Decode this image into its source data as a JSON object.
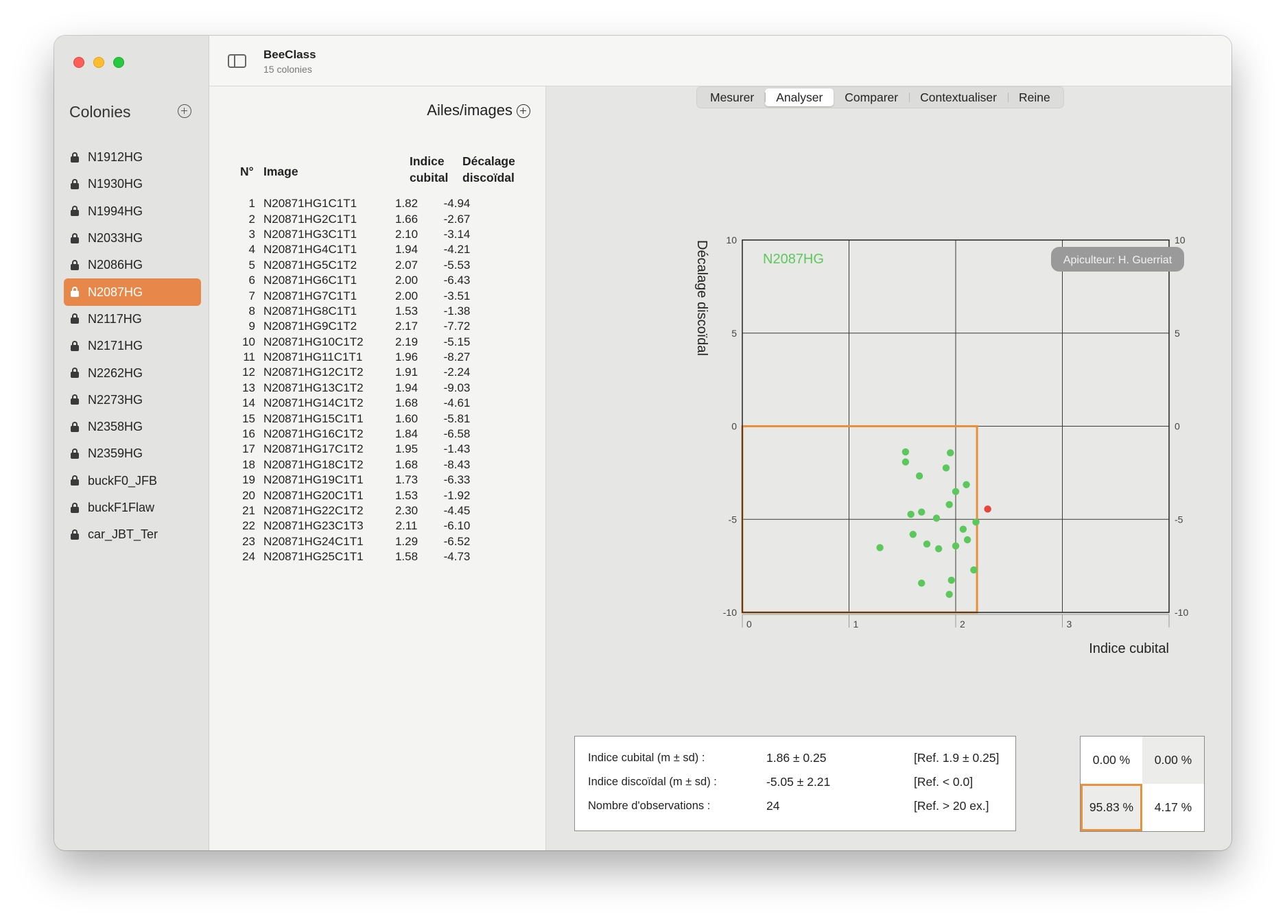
{
  "app": {
    "title": "BeeClass",
    "subtitle": "15 colonies"
  },
  "sidebar": {
    "title": "Colonies",
    "items": [
      {
        "label": "N1912HG"
      },
      {
        "label": "N1930HG"
      },
      {
        "label": "N1994HG"
      },
      {
        "label": "N2033HG"
      },
      {
        "label": "N2086HG"
      },
      {
        "label": "N2087HG",
        "selected": true
      },
      {
        "label": "N2117HG"
      },
      {
        "label": "N2171HG"
      },
      {
        "label": "N2262HG"
      },
      {
        "label": "N2273HG"
      },
      {
        "label": "N2358HG"
      },
      {
        "label": "N2359HG"
      },
      {
        "label": "buckF0_JFB"
      },
      {
        "label": "buckF1Flaw"
      },
      {
        "label": "car_JBT_Ter"
      }
    ]
  },
  "wings": {
    "title": "Ailes/images",
    "headers": {
      "num": "N°",
      "image": "Image",
      "cubital": "Indice cubital",
      "discoidal": "Décalage discoïdal"
    },
    "rows": [
      {
        "n": "1",
        "image": "N20871HG1C1T1",
        "ci": "1.82",
        "dd": "-4.94"
      },
      {
        "n": "2",
        "image": "N20871HG2C1T1",
        "ci": "1.66",
        "dd": "-2.67"
      },
      {
        "n": "3",
        "image": "N20871HG3C1T1",
        "ci": "2.10",
        "dd": "-3.14"
      },
      {
        "n": "4",
        "image": "N20871HG4C1T1",
        "ci": "1.94",
        "dd": "-4.21"
      },
      {
        "n": "5",
        "image": "N20871HG5C1T2",
        "ci": "2.07",
        "dd": "-5.53"
      },
      {
        "n": "6",
        "image": "N20871HG6C1T1",
        "ci": "2.00",
        "dd": "-6.43"
      },
      {
        "n": "7",
        "image": "N20871HG7C1T1",
        "ci": "2.00",
        "dd": "-3.51"
      },
      {
        "n": "8",
        "image": "N20871HG8C1T1",
        "ci": "1.53",
        "dd": "-1.38"
      },
      {
        "n": "9",
        "image": "N20871HG9C1T2",
        "ci": "2.17",
        "dd": "-7.72"
      },
      {
        "n": "10",
        "image": "N20871HG10C1T2",
        "ci": "2.19",
        "dd": "-5.15"
      },
      {
        "n": "11",
        "image": "N20871HG11C1T1",
        "ci": "1.96",
        "dd": "-8.27"
      },
      {
        "n": "12",
        "image": "N20871HG12C1T2",
        "ci": "1.91",
        "dd": "-2.24"
      },
      {
        "n": "13",
        "image": "N20871HG13C1T2",
        "ci": "1.94",
        "dd": "-9.03"
      },
      {
        "n": "14",
        "image": "N20871HG14C1T2",
        "ci": "1.68",
        "dd": "-4.61"
      },
      {
        "n": "15",
        "image": "N20871HG15C1T1",
        "ci": "1.60",
        "dd": "-5.81"
      },
      {
        "n": "16",
        "image": "N20871HG16C1T2",
        "ci": "1.84",
        "dd": "-6.58"
      },
      {
        "n": "17",
        "image": "N20871HG17C1T2",
        "ci": "1.95",
        "dd": "-1.43"
      },
      {
        "n": "18",
        "image": "N20871HG18C1T2",
        "ci": "1.68",
        "dd": "-8.43"
      },
      {
        "n": "19",
        "image": "N20871HG19C1T1",
        "ci": "1.73",
        "dd": "-6.33"
      },
      {
        "n": "20",
        "image": "N20871HG20C1T1",
        "ci": "1.53",
        "dd": "-1.92"
      },
      {
        "n": "21",
        "image": "N20871HG22C1T2",
        "ci": "2.30",
        "dd": "-4.45"
      },
      {
        "n": "22",
        "image": "N20871HG23C1T3",
        "ci": "2.11",
        "dd": "-6.10"
      },
      {
        "n": "23",
        "image": "N20871HG24C1T1",
        "ci": "1.29",
        "dd": "-6.52"
      },
      {
        "n": "24",
        "image": "N20871HG25C1T1",
        "ci": "1.58",
        "dd": "-4.73"
      }
    ]
  },
  "tabs": [
    {
      "label": "Mesurer"
    },
    {
      "label": "Analyser",
      "active": true
    },
    {
      "label": "Comparer"
    },
    {
      "label": "Contextualiser"
    },
    {
      "label": "Reine"
    }
  ],
  "chart_data": {
    "type": "scatter",
    "title": "N2087HG",
    "badge": "Apiculteur: H. Guerriat",
    "xlabel": "Indice cubital",
    "ylabel": "Décalage discoïdal",
    "xlim": [
      0,
      4
    ],
    "ylim": [
      -10,
      10
    ],
    "xticks": [
      "0",
      "1",
      "2",
      "3"
    ],
    "yticks": [
      "10",
      "5",
      "0",
      "-5",
      "-10"
    ],
    "grid": true,
    "reference_box": {
      "x": [
        0,
        2.2
      ],
      "y": [
        -10,
        0
      ],
      "color": "#e8903c"
    },
    "point_colors": {
      "inside": "#5cc85c",
      "outside": "#e8443a"
    },
    "points": [
      [
        1.82,
        -4.94
      ],
      [
        1.66,
        -2.67
      ],
      [
        2.1,
        -3.14
      ],
      [
        1.94,
        -4.21
      ],
      [
        2.07,
        -5.53
      ],
      [
        2.0,
        -6.43
      ],
      [
        2.0,
        -3.51
      ],
      [
        1.53,
        -1.38
      ],
      [
        2.17,
        -7.72
      ],
      [
        2.19,
        -5.15
      ],
      [
        1.96,
        -8.27
      ],
      [
        1.91,
        -2.24
      ],
      [
        1.94,
        -9.03
      ],
      [
        1.68,
        -4.61
      ],
      [
        1.6,
        -5.81
      ],
      [
        1.84,
        -6.58
      ],
      [
        1.95,
        -1.43
      ],
      [
        1.68,
        -8.43
      ],
      [
        1.73,
        -6.33
      ],
      [
        1.53,
        -1.92
      ],
      [
        2.3,
        -4.45
      ],
      [
        2.11,
        -6.1
      ],
      [
        1.29,
        -6.52
      ],
      [
        1.58,
        -4.73
      ]
    ]
  },
  "stats": {
    "rows": [
      {
        "label": "Indice cubital (m ± sd) :",
        "value": "1.86 ± 0.25",
        "ref": "[Ref. 1.9 ± 0.25]"
      },
      {
        "label": "Indice discoïdal (m ± sd) :",
        "value": "-5.05 ± 2.21",
        "ref": "[Ref. < 0.0]"
      },
      {
        "label": "Nombre d'observations :",
        "value": "24",
        "ref": "[Ref. > 20 ex.]"
      }
    ]
  },
  "quadrants": {
    "top_left": "0.00 %",
    "top_right": "0.00 %",
    "bottom_left": "95.83 %",
    "bottom_right": "4.17 %"
  }
}
